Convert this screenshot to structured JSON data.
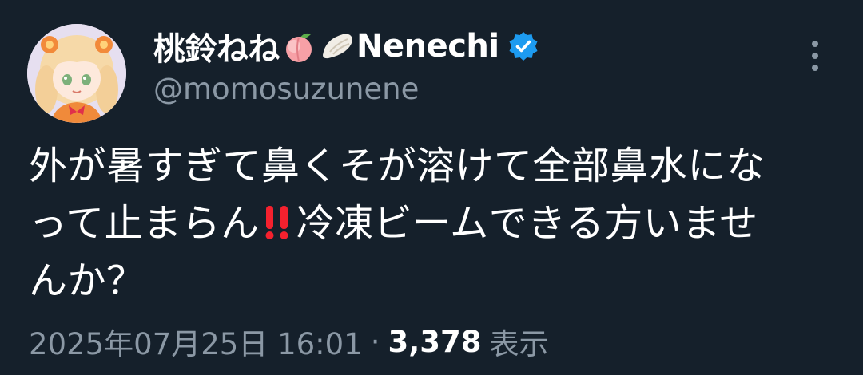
{
  "author": {
    "display_name": "桃鈴ねね",
    "display_name_suffix": "Nenechi",
    "name_emojis": [
      "peach-emoji",
      "dumpling-emoji"
    ],
    "verified": true,
    "handle": "@momosuzunene"
  },
  "tweet": {
    "line1": "外が暑すぎて鼻くそが溶けて全部鼻水にな",
    "line2_start": "って止まらん",
    "line2_end": "冷凍ビームできる方いませ",
    "line3": "んか？"
  },
  "meta": {
    "timestamp": "2025年07月25日 16:01",
    "separator": "·",
    "views_count": "3,378",
    "views_label": "表示"
  },
  "colors": {
    "background": "#15202b",
    "primary_text": "#ffffff",
    "secondary_text": "#8b98a5",
    "verified_badge": "#1d9bf0",
    "double_exclamation": "#f4212e"
  },
  "icons": {
    "more": "more-vertical-icon",
    "verified": "verified-badge-icon",
    "emphasis": "double-exclamation-icon"
  }
}
